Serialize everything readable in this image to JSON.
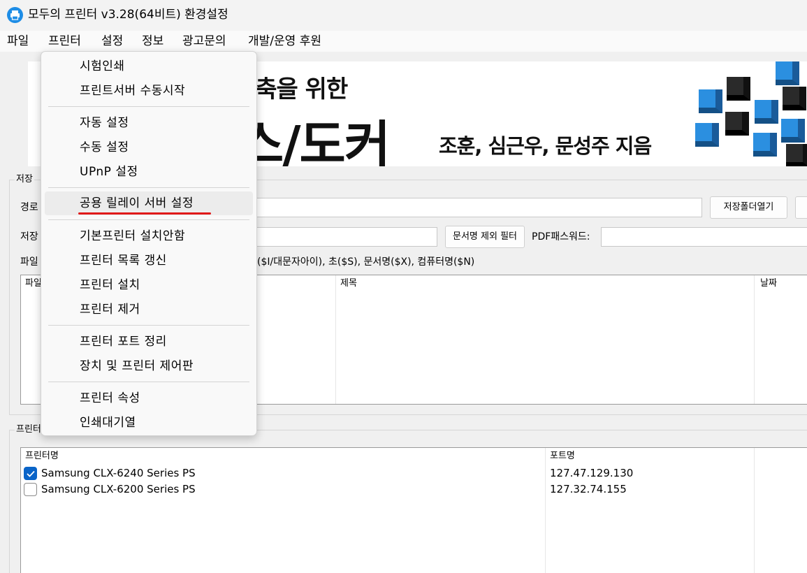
{
  "window": {
    "title": "모두의 프린터 v3.28(64비트) 환경설정"
  },
  "menubar": [
    "파일",
    "프린터",
    "설정",
    "정보",
    "광고문의",
    "개발/운영 후원"
  ],
  "ad": {
    "line1": "구축을 위한",
    "line2": "스/도커",
    "line3": "조훈, 심근우, 문성주 지음"
  },
  "save_section": {
    "group_label": "저장",
    "path_label": "경로",
    "save_label": "저장",
    "file_label": "파일",
    "open_folder_button": "저장폴더열기",
    "doc_filter_button": "문서명 제외 필터",
    "pdf_password_label": "PDF패스워드:",
    "pattern_hint": "($I/대문자아이), 초($S), 문서명($X), 컴퓨터명($N)",
    "file_list_columns": [
      "파일",
      "제목",
      "날짜"
    ]
  },
  "printer_section": {
    "group_label": "프린터",
    "columns": [
      "프린터명",
      "포트명"
    ],
    "printers": [
      {
        "name": "Samsung CLX-6240 Series PS",
        "port": "127.47.129.130",
        "checked": true
      },
      {
        "name": "Samsung CLX-6200 Series PS",
        "port": "127.32.74.155",
        "checked": false
      }
    ]
  },
  "printer_menu": {
    "groups": [
      [
        "시험인쇄",
        "프린트서버 수동시작"
      ],
      [
        "자동 설정",
        "수동 설정",
        "UPnP 설정"
      ],
      [
        "공용 릴레이 서버 설정"
      ],
      [
        "기본프린터 설치안함",
        "프린터 목록 갱신",
        "프린터 설치",
        "프린터 제거"
      ],
      [
        "프린터 포트 정리",
        "장치 및 프린터 제어판"
      ],
      [
        "프린터 속성",
        "인쇄대기열"
      ]
    ]
  },
  "colors": {
    "accent": "#0a64c8",
    "highlight_underline": "#e01818",
    "app_icon": "#1e8de6"
  }
}
